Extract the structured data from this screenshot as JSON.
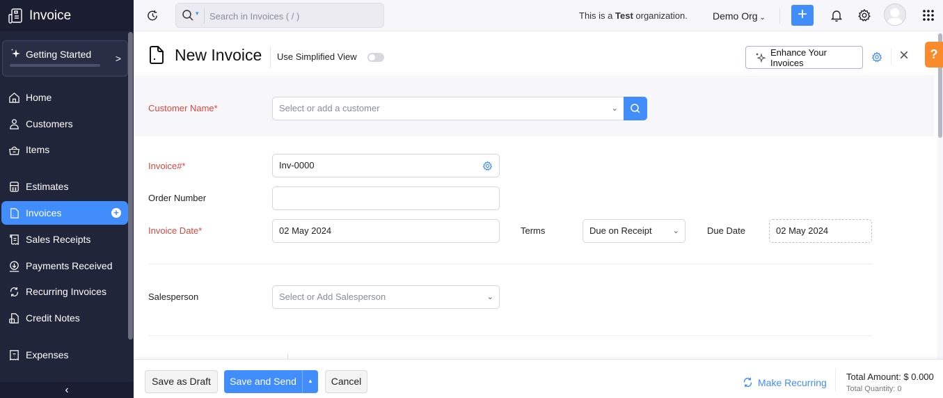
{
  "app": {
    "name": "Invoice"
  },
  "sidebar": {
    "getting_started": "Getting Started",
    "items": [
      {
        "label": "Home",
        "icon": "home-icon"
      },
      {
        "label": "Customers",
        "icon": "user-icon"
      },
      {
        "label": "Items",
        "icon": "basket-icon"
      },
      {
        "label": "Estimates",
        "icon": "calculator-icon"
      },
      {
        "label": "Invoices",
        "icon": "invoice-icon",
        "active": true
      },
      {
        "label": "Sales Receipts",
        "icon": "receipt-icon"
      },
      {
        "label": "Payments Received",
        "icon": "download-circle-icon"
      },
      {
        "label": "Recurring Invoices",
        "icon": "recurring-icon"
      },
      {
        "label": "Credit Notes",
        "icon": "credit-note-icon"
      },
      {
        "label": "Expenses",
        "icon": "expense-icon"
      }
    ],
    "collapse_glyph": "‹"
  },
  "topbar": {
    "search_placeholder": "Search in Invoices ( / )",
    "org_note_prefix": "This is a ",
    "org_note_bold": "Test",
    "org_note_suffix": " organization.",
    "org_name": "Demo Org",
    "add_glyph": "+",
    "apps_glyph": "⋮⋮⋮"
  },
  "header": {
    "title": "New Invoice",
    "simplified_view_label": "Use Simplified View",
    "simplified_view_on": false,
    "enhance_label": "Enhance Your Invoices",
    "close_glyph": "×",
    "help_glyph": "?"
  },
  "form": {
    "customer_label": "Customer Name*",
    "customer_placeholder": "Select or add a customer",
    "invoice_no_label": "Invoice#*",
    "invoice_no_value": "Inv-0000",
    "order_number_label": "Order Number",
    "order_number_value": "",
    "invoice_date_label": "Invoice Date*",
    "invoice_date_value": "02 May 2024",
    "terms_label": "Terms",
    "terms_value": "Due on Receipt",
    "due_date_label": "Due Date",
    "due_date_value": "02 May 2024",
    "salesperson_label": "Salesperson",
    "salesperson_placeholder": "Select or Add Salesperson"
  },
  "footer": {
    "save_draft": "Save as Draft",
    "save_send": "Save and Send",
    "cancel": "Cancel",
    "make_recurring": "Make Recurring",
    "total_amount": "Total Amount: $ 0.000",
    "total_quantity": "Total Quantity: 0"
  },
  "colors": {
    "accent": "#408dfb",
    "sidebar_bg": "#21253a",
    "required": "#d9463e",
    "help": "#f98b2c"
  }
}
